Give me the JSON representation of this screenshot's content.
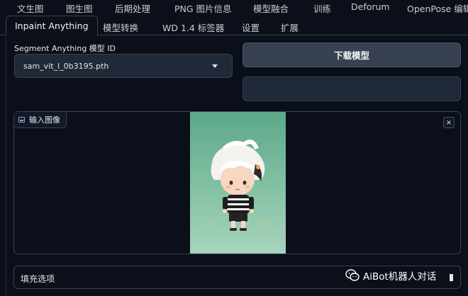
{
  "top_tabs": [
    "文生图",
    "图生图",
    "后期处理",
    "PNG 图片信息",
    "模型融合",
    "训练",
    "Deforum",
    "OpenPose 编辑"
  ],
  "sub_tabs": [
    "Inpaint Anything",
    "模型转换",
    "WD 1.4 标签器",
    "设置",
    "扩展"
  ],
  "model": {
    "label": "Segment Anything 模型 ID",
    "selected": "sam_vit_l_0b3195.pth"
  },
  "download_button": "下载模型",
  "image_panel": {
    "label": "输入图像",
    "close": "×",
    "image_icon": "image-icon"
  },
  "fill_options": {
    "title": "填充选项"
  },
  "watermark": "AiBot机器人对话",
  "colors": {
    "background": "#0b0f19",
    "panel": "#1f2937",
    "border": "#374151",
    "button": "#374151",
    "preview_bg": "#6fb59a"
  }
}
